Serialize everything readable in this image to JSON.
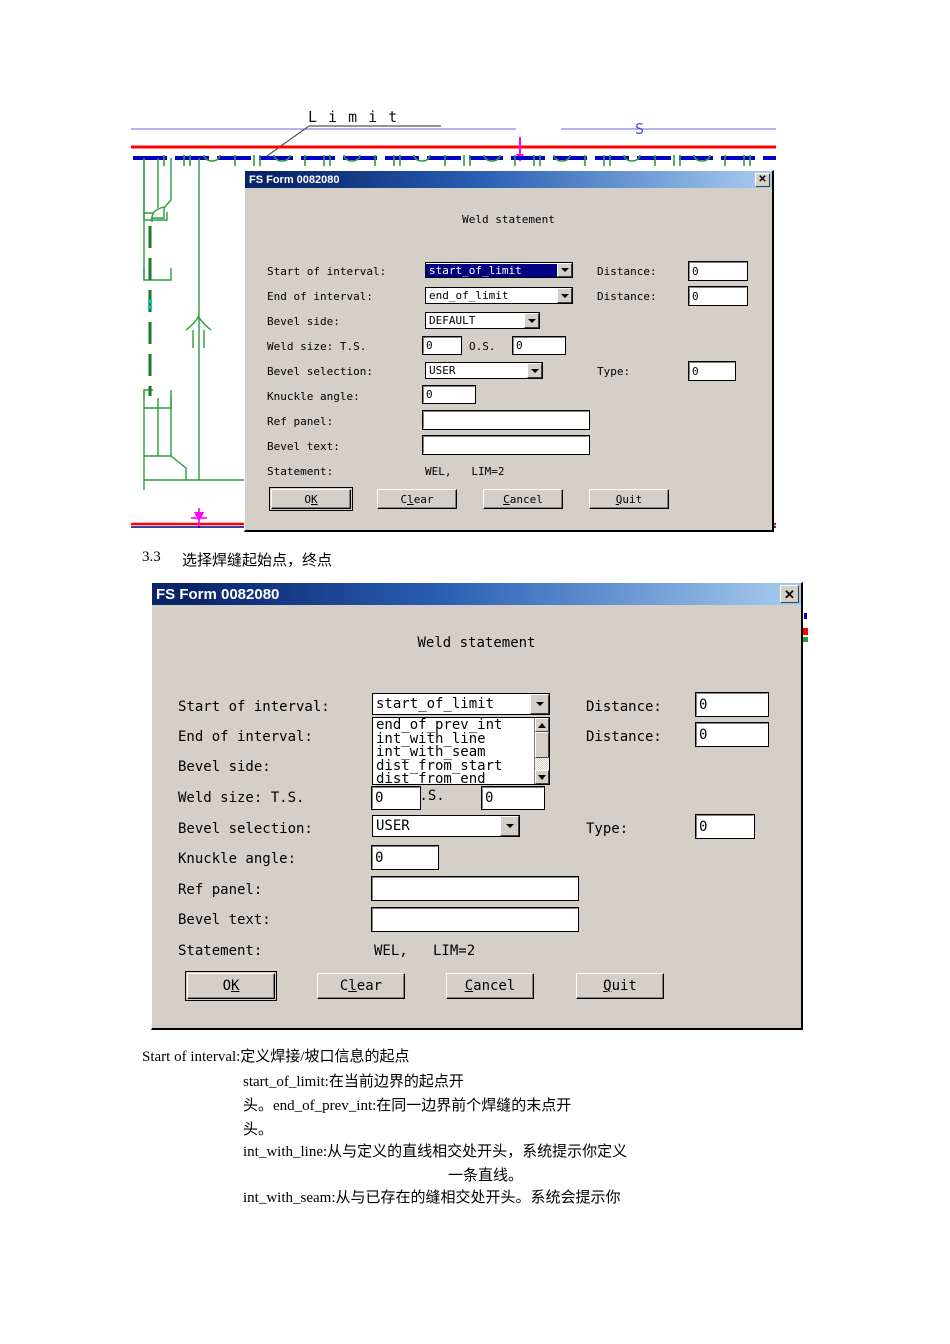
{
  "drawing": {
    "limit_label": "L i m i t",
    "s_label": "S",
    "colors": {
      "red_line": "#ff0000",
      "blue_line": "#0000c8",
      "green": "#2e9a3e",
      "dark_green": "#1a7a2a",
      "magenta": "#ff00ff",
      "light_blue": "#6a6adf",
      "leader_gray": "#555555"
    }
  },
  "dialog1": {
    "title": "FS Form 0082080",
    "close_label": "✕",
    "form_title": "Weld statement",
    "labels": {
      "start_of_interval": "Start of interval:",
      "end_of_interval": "End of interval:",
      "bevel_side": "Bevel side:",
      "weld_size": "Weld size:    T.S.",
      "os": "O.S.",
      "bevel_selection": "Bevel selection:",
      "knuckle_angle": "Knuckle angle:",
      "ref_panel": "Ref panel:",
      "bevel_text": "Bevel text:",
      "statement": "Statement:",
      "distance1": "Distance:",
      "distance2": "Distance:",
      "type": "Type:"
    },
    "values": {
      "start_of_interval": "start_of_limit",
      "end_of_interval": "end_of_limit",
      "bevel_side": "DEFAULT",
      "weld_size_ts": "0",
      "weld_size_os": "0",
      "bevel_selection": "USER",
      "knuckle_angle": "0",
      "ref_panel": "",
      "bevel_text": "",
      "statement": "WEL,   LIM=2",
      "distance1": "0",
      "distance2": "0",
      "type": "0"
    },
    "buttons": {
      "ok": "OK",
      "clear": "Clear",
      "cancel": "Cancel",
      "quit": "Quit"
    }
  },
  "section": {
    "number": "3.3",
    "heading": "选择焊缝起始点，终点"
  },
  "dialog2": {
    "title": "FS Form 0082080",
    "close_label": "✕",
    "form_title": "Weld statement",
    "labels": {
      "start_of_interval": "Start of interval:",
      "end_of_interval": "End of interval:",
      "bevel_side": "Bevel side:",
      "weld_size": "Weld size:   T.S.",
      "os": "O.S.",
      "bevel_selection": "Bevel selection:",
      "knuckle_angle": "Knuckle angle:",
      "ref_panel": "Ref panel:",
      "bevel_text": "Bevel text:",
      "statement": "Statement:",
      "distance1": "Distance:",
      "distance2": "Distance:",
      "type": "Type:"
    },
    "values": {
      "start_of_interval": "start_of_limit",
      "weld_size_ts": "0",
      "weld_size_os": "0",
      "bevel_selection": "USER",
      "knuckle_angle": "0",
      "ref_panel": "",
      "bevel_text": "",
      "statement": "WEL,   LIM=2",
      "distance1": "0",
      "distance2": "0",
      "type": "0"
    },
    "dropdown_open": {
      "options": [
        "end_of_prev_int",
        "int_with_line",
        "int_with_seam",
        "dist_from_start",
        "dist_from_end"
      ]
    },
    "buttons": {
      "ok": "OK",
      "clear": "Clear",
      "cancel": "Cancel",
      "quit": "Quit"
    }
  },
  "notes": {
    "line1": "Start of interval:定义焊接/坡口信息的起点",
    "line2": "start_of_limit:在当前边界的起点开",
    "line3": "头。end_of_prev_int:在同一边界前个焊缝的末点开",
    "line4": "头。",
    "line5": "int_with_line:从与定义的直线相交处开头，系统提示你定义",
    "line6": "一条直线。",
    "line7": "int_with_seam:从与已存在的缝相交处开头。系统会提示你"
  }
}
